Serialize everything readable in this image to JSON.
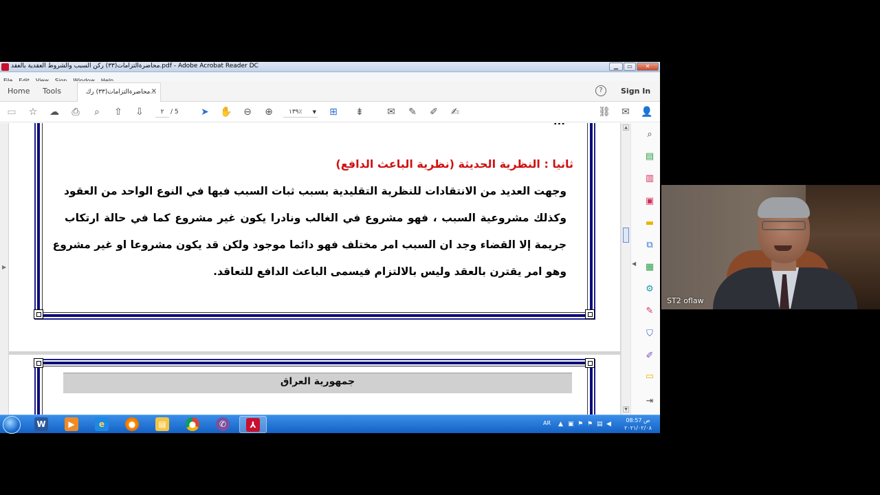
{
  "window": {
    "title": "محاضرةالتزامات(٣٣) ركن السبب والشروط العقدية بالعقد.pdf - Adobe Acrobat Reader DC",
    "controls": [
      "▁",
      "▭",
      "✕"
    ]
  },
  "menu": [
    "File",
    "Edit",
    "View",
    "Sign",
    "Window",
    "Help"
  ],
  "tabs": {
    "home": "Home",
    "tools": "Tools",
    "document": "محاضرةالتزامات(٣٣) رك...",
    "close": "×",
    "help": "?",
    "signin": "Sign In"
  },
  "toolbar": {
    "page_current": "٢",
    "page_total": "/ 5",
    "zoom": "١٣٩٪"
  },
  "document": {
    "top_fragment": "...",
    "heading": "ثانيا : النظرية الحديثة (نظرية الباعث الدافع)",
    "paragraph_lines": [
      "وجهت العديد من الانتقادات للنظرية التقليدية  بسبب ثبات السبب فيها في النوع الواحد من العقود",
      "وكذلك مشروعية السبب ، فهو مشروع في الغالب ونادرا يكون غير مشروع كما في حالة ارتكاب",
      "جريمة إلا القضاء وجد ان السبب امر مختلف فهو دائما موجود ولكن قد يكون مشروعا او غير مشروع",
      "وهو امر يقترن بالعقد وليس بالالتزام فيسمى الباعث الدافع للتعاقد."
    ],
    "next_page_header": "جمهورية العراق"
  },
  "taskbar": {
    "language": "AR",
    "time": "08:57 ص",
    "date": "٢٠٢١/٠٢/٠٨"
  },
  "webcam": {
    "participant": "ST2 oflaw"
  },
  "colors": {
    "heading_red": "#d01010",
    "frame_blue": "#0d0d7a",
    "taskbar_blue": "#1462c5"
  }
}
